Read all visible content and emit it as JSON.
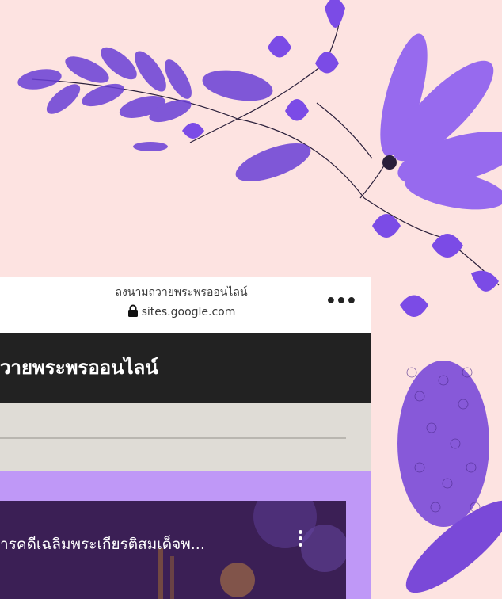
{
  "browser": {
    "page_name": "ลงนามถวายพระพรออนไลน์",
    "domain": "sites.google.com"
  },
  "site": {
    "title": "วายพระพรออนไลน์"
  },
  "video": {
    "title": "ารคดีเฉลิมพระเกียรติสมเด็จพ..."
  },
  "colors": {
    "background": "#fde3e1",
    "accent_purple": "#bf98f7",
    "header_dark": "#222222"
  }
}
